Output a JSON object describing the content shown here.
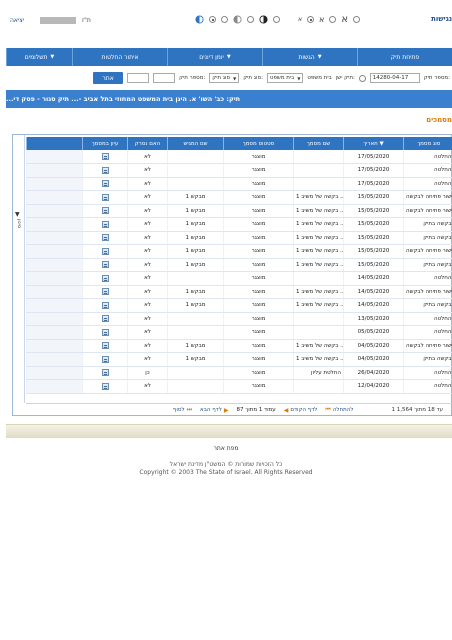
{
  "header": {
    "brand": "נגישות",
    "user_label": "ת\"ז",
    "exit_label": "יציאה",
    "access_letters": [
      "א",
      "א",
      "א"
    ]
  },
  "menu": {
    "items": [
      {
        "label": "פתיחת תיק",
        "caret": ""
      },
      {
        "label": "הגשות",
        "caret": "▼"
      },
      {
        "label": "יומן דיונים",
        "caret": "▼"
      },
      {
        "label": "איתור החלטות",
        "caret": ""
      },
      {
        "label": "תשלומים",
        "caret": "▼"
      }
    ]
  },
  "search": {
    "file_number_label": "מספר תיק:",
    "file_number_value": "14280-04-17",
    "old_file_label": "תיק ישן:",
    "court_label": "בית משפט",
    "court_select": "בית משפט",
    "case_type_label": "סוג תיק:",
    "case_type_select": "סוג תיק",
    "case_number_label": "מספר תיק:",
    "go_button": "אתר"
  },
  "case_title": "תיק: כב' השו' א. היגן בית המשפט המחוזי בתל אביב -... תיק סגור - פסק די...",
  "section_title": "מסמכים",
  "grid": {
    "columns": [
      "סוג מסמך",
      "תאריך ▼",
      "שם מסמך",
      "סטטוס מסמך",
      "שם המגיש",
      "האם נסרק",
      "עיון במסמך"
    ],
    "rows": [
      {
        "type": "החלטה",
        "date": "17/05/2020",
        "name": "",
        "status": "מוצגר",
        "submitter": "",
        "scanned": "לא"
      },
      {
        "type": "החלטה",
        "date": "17/05/2020",
        "name": "",
        "status": "מוצגר",
        "submitter": "",
        "scanned": "לא"
      },
      {
        "type": "החלטה",
        "date": "17/05/2020",
        "name": "",
        "status": "מוצגר",
        "submitter": "",
        "scanned": "לא"
      },
      {
        "type": "אישור פתיחה לבקשה",
        "date": "15/05/2020",
        "name": "בקשה של משיב 1 ...",
        "status": "מוצגר",
        "submitter": "מבקש 1",
        "scanned": "לא"
      },
      {
        "type": "אישור פתיחה לבקשה",
        "date": "15/05/2020",
        "name": "בקשה של משיב 1 ...",
        "status": "מוצגר",
        "submitter": "מבקש 1",
        "scanned": "לא"
      },
      {
        "type": "בקשה בתיק",
        "date": "15/05/2020",
        "name": "בקשה של משיב 1 ...",
        "status": "מוצגר",
        "submitter": "מבקש 1",
        "scanned": "לא"
      },
      {
        "type": "בקשה בתיק",
        "date": "15/05/2020",
        "name": "בקשה של משיב 1 ...",
        "status": "מוצגר",
        "submitter": "מבקש 1",
        "scanned": "לא"
      },
      {
        "type": "אישור פתיחה לבקשה",
        "date": "15/05/2020",
        "name": "בקשה של משיב 1 ...",
        "status": "מוצגר",
        "submitter": "מבקש 1",
        "scanned": "לא"
      },
      {
        "type": "בקשה בתיק",
        "date": "15/05/2020",
        "name": "בקשה של משיב 1 ...",
        "status": "מוצגר",
        "submitter": "מבקש 1",
        "scanned": "לא"
      },
      {
        "type": "החלטה",
        "date": "14/05/2020",
        "name": "",
        "status": "מוצגר",
        "submitter": "",
        "scanned": "לא"
      },
      {
        "type": "אישור פתיחה לבקשה",
        "date": "14/05/2020",
        "name": "בקשה של משיב 1 ...",
        "status": "מוצגר",
        "submitter": "מבקש 1",
        "scanned": "לא"
      },
      {
        "type": "בקשה בתיק",
        "date": "14/05/2020",
        "name": "בקשה של משיב 1 ...",
        "status": "מוצגר",
        "submitter": "מבקש 1",
        "scanned": "לא"
      },
      {
        "type": "החלטה",
        "date": "13/05/2020",
        "name": "",
        "status": "מוצגר",
        "submitter": "",
        "scanned": "לא"
      },
      {
        "type": "החלטה",
        "date": "05/05/2020",
        "name": "",
        "status": "מוצגר",
        "submitter": "",
        "scanned": "לא"
      },
      {
        "type": "אישור פתיחה לבקשה",
        "date": "04/05/2020",
        "name": "בקשה של משיב 1 ...",
        "status": "מוצגר",
        "submitter": "מבקש 1",
        "scanned": "לא"
      },
      {
        "type": "בקשה בתיק",
        "date": "04/05/2020",
        "name": "בקשה של משיב 1 ...",
        "status": "מוצגר",
        "submitter": "מבקש 1",
        "scanned": "לא"
      },
      {
        "type": "החלטה",
        "date": "26/04/2020",
        "name": "החלטת עליון",
        "status": "מוצגר",
        "submitter": "",
        "scanned": "כן"
      },
      {
        "type": "החלטה",
        "date": "12/04/2020",
        "name": "",
        "status": "מוצגר",
        "submitter": "",
        "scanned": "לא"
      }
    ]
  },
  "pager": {
    "status": "1 עד 18 מתוך 1,564",
    "first": "להתחלה",
    "prev": "לדף הקודם",
    "page_info": "עמוד 1 מתוך 87",
    "next": "לדף הבא",
    "last": "לסוף"
  },
  "side_filter_label": "סינון",
  "footer": {
    "sitemap": "מפת אתר",
    "rights_he": "כל הזכויות שמורות © המשט\"ן מדינת ישראל",
    "copyright": "Copyright © 2003 The State of Israel. All Rights Reserved"
  }
}
